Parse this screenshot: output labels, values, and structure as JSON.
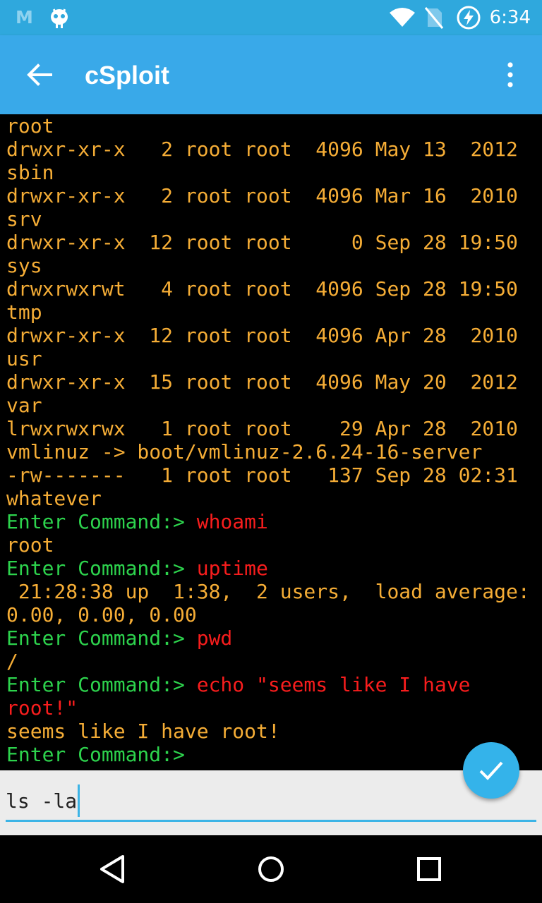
{
  "status_bar": {
    "time": "6:34",
    "app_icon_letter": "M"
  },
  "app_bar": {
    "title": "cSploit"
  },
  "terminal": {
    "colors": {
      "output": "#F5AD36",
      "prompt": "#2DD34D",
      "command": "#F81D1D"
    },
    "lines": [
      [
        {
          "t": "root",
          "c": "out"
        }
      ],
      [
        {
          "t": "drwxr-xr-x   2 root root  4096 May 13  2012",
          "c": "out"
        }
      ],
      [
        {
          "t": "sbin",
          "c": "out"
        }
      ],
      [
        {
          "t": "drwxr-xr-x   2 root root  4096 Mar 16  2010",
          "c": "out"
        }
      ],
      [
        {
          "t": "srv",
          "c": "out"
        }
      ],
      [
        {
          "t": "drwxr-xr-x  12 root root     0 Sep 28 19:50",
          "c": "out"
        }
      ],
      [
        {
          "t": "sys",
          "c": "out"
        }
      ],
      [
        {
          "t": "drwxrwxrwt   4 root root  4096 Sep 28 19:50",
          "c": "out"
        }
      ],
      [
        {
          "t": "tmp",
          "c": "out"
        }
      ],
      [
        {
          "t": "drwxr-xr-x  12 root root  4096 Apr 28  2010",
          "c": "out"
        }
      ],
      [
        {
          "t": "usr",
          "c": "out"
        }
      ],
      [
        {
          "t": "drwxr-xr-x  15 root root  4096 May 20  2012",
          "c": "out"
        }
      ],
      [
        {
          "t": "var",
          "c": "out"
        }
      ],
      [
        {
          "t": "lrwxrwxrwx   1 root root    29 Apr 28  2010",
          "c": "out"
        }
      ],
      [
        {
          "t": "vmlinuz -> boot/vmlinuz-2.6.24-16-server",
          "c": "out"
        }
      ],
      [
        {
          "t": "-rw-------   1 root root   137 Sep 28 02:31",
          "c": "out"
        }
      ],
      [
        {
          "t": "whatever",
          "c": "out"
        }
      ],
      [
        {
          "t": "Enter Command:> ",
          "c": "prompt"
        },
        {
          "t": "whoami",
          "c": "cmd"
        }
      ],
      [
        {
          "t": "root",
          "c": "out"
        }
      ],
      [
        {
          "t": "Enter Command:> ",
          "c": "prompt"
        },
        {
          "t": "uptime",
          "c": "cmd"
        }
      ],
      [
        {
          "t": " 21:28:38 up  1:38,  2 users,  load average:",
          "c": "out"
        }
      ],
      [
        {
          "t": "0.00, 0.00, 0.00",
          "c": "out"
        }
      ],
      [
        {
          "t": "Enter Command:> ",
          "c": "prompt"
        },
        {
          "t": "pwd",
          "c": "cmd"
        }
      ],
      [
        {
          "t": "/",
          "c": "out"
        }
      ],
      [
        {
          "t": "Enter Command:> ",
          "c": "prompt"
        },
        {
          "t": "echo \"seems like I have",
          "c": "cmd"
        }
      ],
      [
        {
          "t": "root!\"",
          "c": "cmd"
        }
      ],
      [
        {
          "t": "seems like I have root!",
          "c": "out"
        }
      ],
      [
        {
          "t": "Enter Command:>",
          "c": "prompt"
        }
      ]
    ]
  },
  "command_input": {
    "value": "ls -la"
  },
  "icons": {
    "back": "arrow-back-icon",
    "overflow": "more-vert-icon",
    "submit": "check-icon",
    "nav": [
      "nav-back-icon",
      "nav-home-icon",
      "nav-recents-icon"
    ]
  }
}
